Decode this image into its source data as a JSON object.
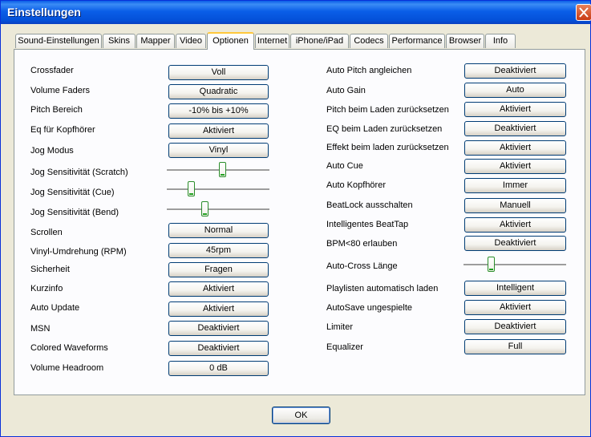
{
  "window": {
    "title": "Einstellungen"
  },
  "tabs": [
    "Sound-Einstellungen",
    "Skins",
    "Mapper",
    "Video",
    "Optionen",
    "Internet",
    "iPhone/iPad",
    "Codecs",
    "Performance",
    "Browser",
    "Info"
  ],
  "active_tab": "Optionen",
  "left": {
    "crossfader": {
      "label": "Crossfader",
      "value": "Voll"
    },
    "volume_faders": {
      "label": "Volume Faders",
      "value": "Quadratic"
    },
    "pitch_bereich": {
      "label": "Pitch Bereich",
      "value": "-10% bis +10%"
    },
    "eq_kopfhoerer": {
      "label": "Eq für Kopfhörer",
      "value": "Aktiviert"
    },
    "jog_modus": {
      "label": "Jog Modus",
      "value": "Vinyl"
    },
    "jog_scratch": {
      "label": "Jog Sensitivität (Scratch)",
      "level": 0.55
    },
    "jog_cue": {
      "label": "Jog Sensitivität (Cue)",
      "level": 0.22
    },
    "jog_bend": {
      "label": "Jog Sensitivität (Bend)",
      "level": 0.36
    },
    "scrollen": {
      "label": "Scrollen",
      "value": "Normal"
    },
    "vinyl_rpm": {
      "label": "Vinyl-Umdrehung (RPM)",
      "value": "45rpm"
    },
    "sicherheit": {
      "label": "Sicherheit",
      "value": "Fragen"
    },
    "kurzinfo": {
      "label": "Kurzinfo",
      "value": "Aktiviert"
    },
    "auto_update": {
      "label": "Auto Update",
      "value": "Aktiviert"
    },
    "msn": {
      "label": "MSN",
      "value": "Deaktiviert"
    },
    "colored_waveforms": {
      "label": "Colored Waveforms",
      "value": "Deaktiviert"
    },
    "volume_headroom": {
      "label": "Volume Headroom",
      "value": "0 dB"
    }
  },
  "right": {
    "auto_pitch": {
      "label": "Auto Pitch angleichen",
      "value": "Deaktiviert"
    },
    "auto_gain": {
      "label": "Auto Gain",
      "value": "Auto"
    },
    "pitch_reset": {
      "label": "Pitch beim Laden zurücksetzen",
      "value": "Aktiviert"
    },
    "eq_reset": {
      "label": "EQ beim Laden zurücksetzen",
      "value": "Deaktiviert"
    },
    "effekt_reset": {
      "label": "Effekt beim laden zurücksetzen",
      "value": "Aktiviert"
    },
    "auto_cue": {
      "label": "Auto Cue",
      "value": "Aktiviert"
    },
    "auto_kopfhoerer": {
      "label": "Auto Kopfhörer",
      "value": "Immer"
    },
    "beatlock": {
      "label": "BeatLock ausschalten",
      "value": "Manuell"
    },
    "beattap": {
      "label": "Intelligentes BeatTap",
      "value": "Aktiviert"
    },
    "bpm80": {
      "label": "BPM<80 erlauben",
      "value": "Deaktiviert"
    },
    "auto_cross": {
      "label": "Auto-Cross Länge",
      "level": 0.25
    },
    "playlisten": {
      "label": "Playlisten automatisch laden",
      "value": "Intelligent"
    },
    "autosave": {
      "label": "AutoSave ungespielte",
      "value": "Aktiviert"
    },
    "limiter": {
      "label": "Limiter",
      "value": "Deaktiviert"
    },
    "equalizer": {
      "label": "Equalizer",
      "value": "Full"
    }
  },
  "ok_label": "OK"
}
